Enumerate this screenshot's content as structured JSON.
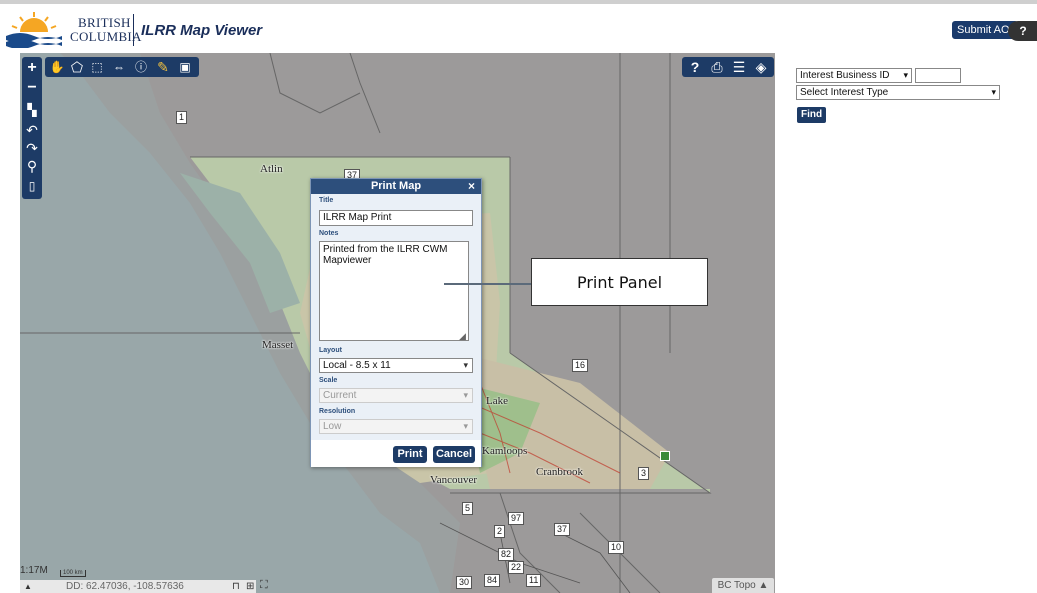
{
  "header": {
    "bc_line1": "BRITISH",
    "bc_line2": "COLUMBIA",
    "app_title": "ILRR Map Viewer",
    "submit_label": "Submit AOI",
    "help_label": "?"
  },
  "map": {
    "labels": [
      "Atlin",
      "Masset",
      "Kamloops",
      "Cranbrook",
      "Vancouver",
      "Lake"
    ],
    "scale_ratio": "1:17M",
    "scale_bar": "100 km",
    "coords": "DD: 62.47036, -108.57636",
    "basemap": "BC Topo ▲",
    "shields": [
      "1",
      "37",
      "16",
      "5",
      "97",
      "2",
      "37",
      "82",
      "22",
      "11",
      "10",
      "30",
      "84",
      "3"
    ]
  },
  "print_dialog": {
    "title": "Print Map",
    "close": "×",
    "title_label": "Title",
    "title_value": "ILRR Map Print",
    "notes_label": "Notes",
    "notes_value": "Printed from the ILRR CWM Mapviewer",
    "layout_label": "Layout",
    "layout_value": "Local - 8.5 x 11",
    "scale_label": "Scale",
    "scale_value": "Current",
    "resolution_label": "Resolution",
    "resolution_value": "Low",
    "print_btn": "Print",
    "cancel_btn": "Cancel"
  },
  "callout": {
    "text": "Print Panel"
  },
  "search": {
    "field_select": "Interest Business ID",
    "type_select": "Select Interest Type",
    "find_label": "Find"
  },
  "icons": {
    "chevron": "⌄"
  }
}
